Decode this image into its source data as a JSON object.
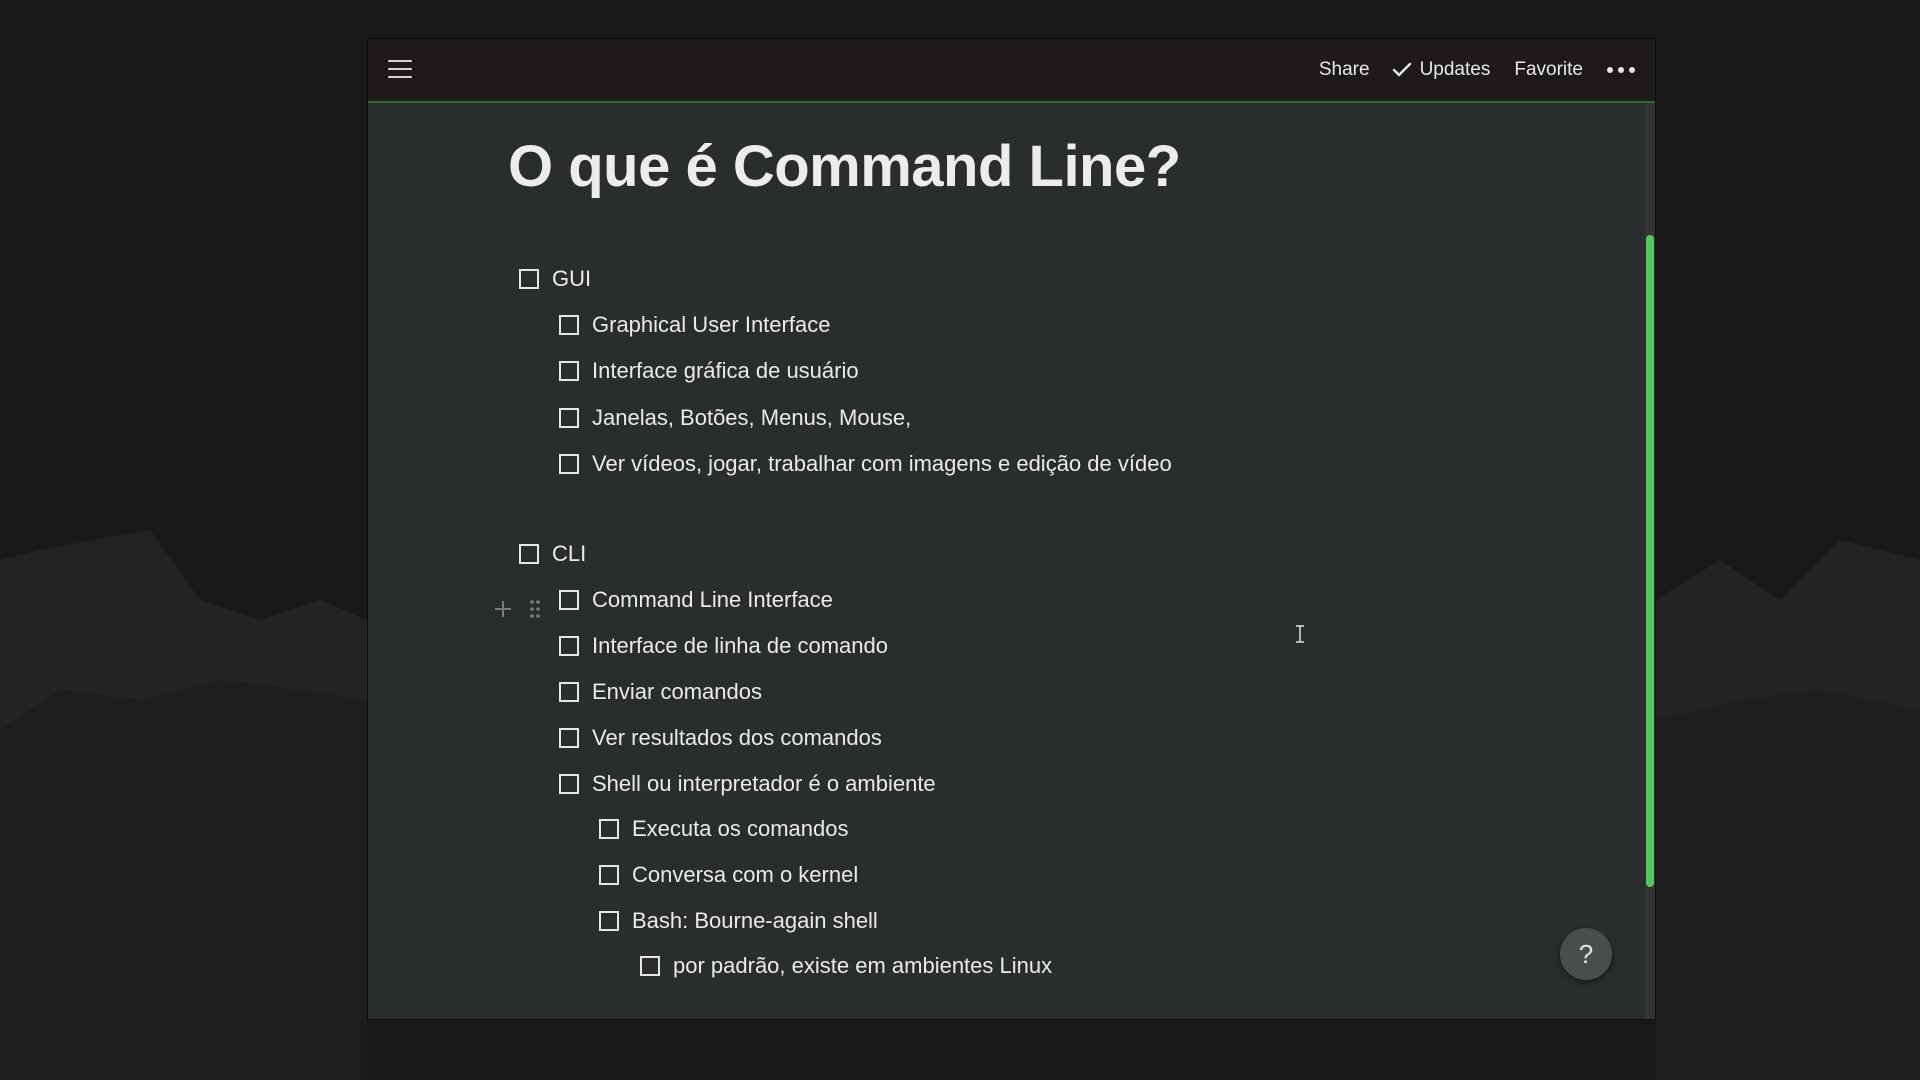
{
  "topbar": {
    "share_label": "Share",
    "updates_label": "Updates",
    "favorite_label": "Favorite"
  },
  "page": {
    "title": "O que é Command Line?",
    "todos": [
      {
        "text": "GUI",
        "checked": false,
        "level": 0
      },
      {
        "text": "Graphical User Interface",
        "checked": false,
        "level": 1
      },
      {
        "text": "Interface gráfica de usuário",
        "checked": false,
        "level": 1
      },
      {
        "text": "Janelas, Botões, Menus, Mouse,",
        "checked": false,
        "level": 1
      },
      {
        "text": "Ver vídeos, jogar, trabalhar com imagens e edição de vídeo",
        "checked": false,
        "level": 1
      },
      {
        "text": "CLI",
        "checked": false,
        "level": 0
      },
      {
        "text": "Command Line Interface",
        "checked": false,
        "level": 1
      },
      {
        "text": "Interface de linha de comando",
        "checked": false,
        "level": 1
      },
      {
        "text": "Enviar comandos",
        "checked": false,
        "level": 1
      },
      {
        "text": "Ver resultados dos comandos",
        "checked": false,
        "level": 1
      },
      {
        "text": "Shell ou interpretador é o ambiente",
        "checked": false,
        "level": 1
      },
      {
        "text": "Executa os comandos",
        "checked": false,
        "level": 2
      },
      {
        "text": "Conversa com o kernel",
        "checked": false,
        "level": 2
      },
      {
        "text": "Bash: Bourne-again shell",
        "checked": false,
        "level": 2
      },
      {
        "text": "por padrão, existe em ambientes Linux",
        "checked": false,
        "level": 3
      }
    ]
  },
  "help": {
    "label": "?"
  },
  "icons": {
    "menu": "hamburger-icon",
    "updates": "checkmark-icon",
    "more": "ellipsis-icon",
    "add_block": "plus-icon",
    "drag": "drag-handle-icon",
    "cursor": "text-cursor-icon"
  },
  "colors": {
    "page_background": "#2a2d2d",
    "topbar_background": "#1e1a1a",
    "accent_green": "#4ecb5a",
    "outer_background": "#191919"
  }
}
